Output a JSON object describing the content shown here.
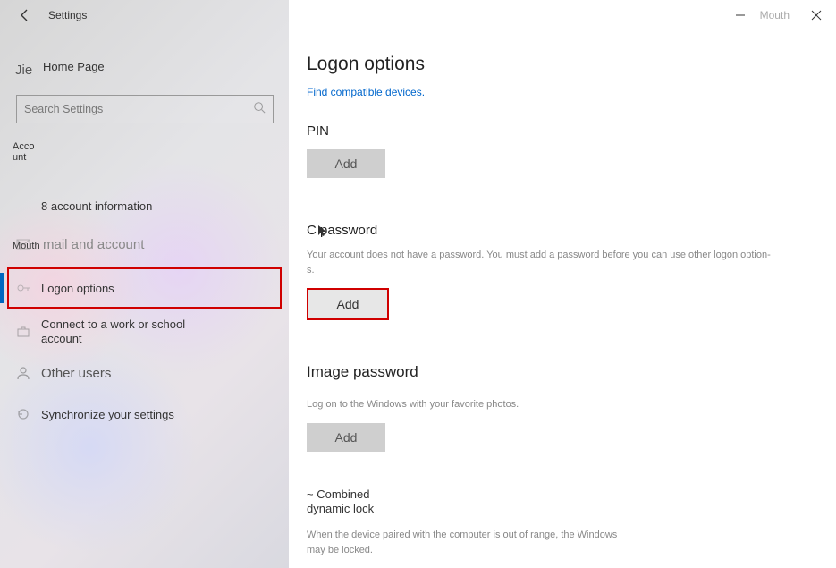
{
  "window": {
    "title": "Settings",
    "right_ghost": "Mouth"
  },
  "sidebar": {
    "ghost_jie": "Jie",
    "ghost_account": "Ac­count",
    "ghost_mouth": "Mouth",
    "home_label": "Home Page",
    "search_placeholder": "Search Settings",
    "items": [
      {
        "label": "8 account information"
      },
      {
        "label": "mail and account"
      },
      {
        "label": "Logon options"
      },
      {
        "label": "Connect to a work or school account"
      },
      {
        "label": "Other users"
      },
      {
        "label": "Synchronize your settings"
      }
    ]
  },
  "page": {
    "title": "Logon options",
    "link_text": "Find compatible devices.",
    "pin": {
      "title": "PIN",
      "button": "Add"
    },
    "password": {
      "title": "C password",
      "desc": "Your account does not have a password. You must add a password before you can use other logon option­s.",
      "button": "Add"
    },
    "image_password": {
      "title": "Image password",
      "desc": "Log on to the Windows with your favorite photos.",
      "button": "Add"
    },
    "dynamic_lock": {
      "title": "~ Combined dy­namic lock",
      "desc": "When the device paired with the computer is out of range, the Windows may be locked."
    }
  }
}
